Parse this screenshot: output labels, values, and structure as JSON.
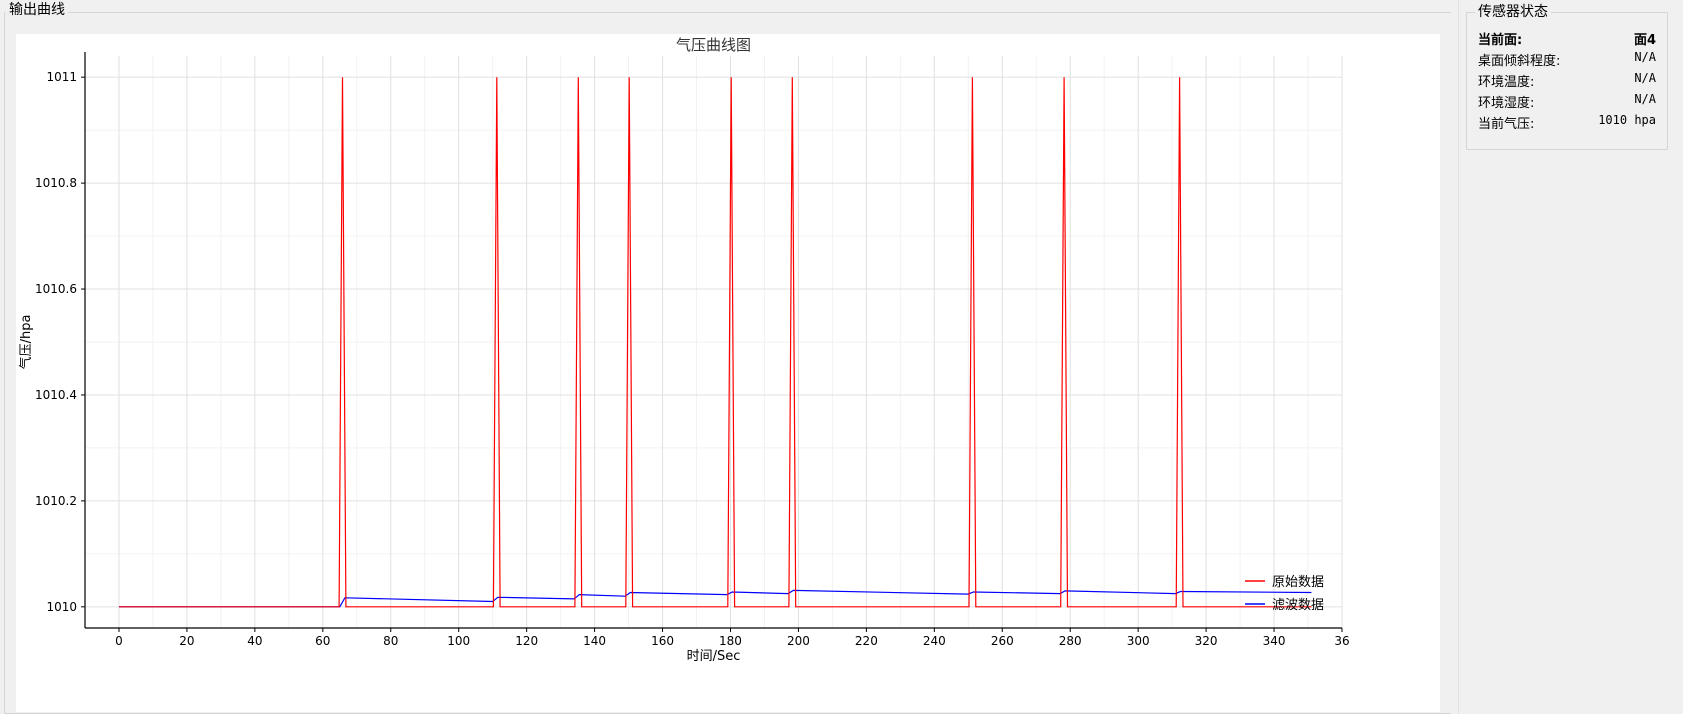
{
  "output_group": {
    "title": "输出曲线"
  },
  "status_group": {
    "title": "传感器状态",
    "rows": [
      {
        "label": "当前面:",
        "value": "面4",
        "bold": true
      },
      {
        "label": "桌面倾斜程度:",
        "value": "N/A"
      },
      {
        "label": "环境温度:",
        "value": "N/A"
      },
      {
        "label": "环境湿度:",
        "value": "N/A"
      },
      {
        "label": "当前气压:",
        "value": "1010 hpa"
      }
    ]
  },
  "chart_data": {
    "type": "line",
    "title": "气压曲线图",
    "xlabel": "时间/Sec",
    "ylabel": "气压/hpa",
    "xlim": [
      -10,
      360
    ],
    "ylim": [
      1009.96,
      1011.04
    ],
    "x_ticks": [
      0,
      20,
      40,
      60,
      80,
      100,
      120,
      140,
      160,
      180,
      200,
      220,
      240,
      260,
      280,
      300,
      320,
      340,
      360
    ],
    "x_tick_labels": [
      "0",
      "20",
      "40",
      "60",
      "80",
      "100",
      "120",
      "140",
      "160",
      "180",
      "200",
      "220",
      "240",
      "260",
      "280",
      "300",
      "320",
      "340",
      "36"
    ],
    "y_ticks": [
      1010,
      1010.2,
      1010.4,
      1010.6,
      1010.8,
      1011
    ],
    "y_tick_labels": [
      "1010",
      "1010.2",
      "1010.4",
      "1010.6",
      "1010.8",
      "1011"
    ],
    "grid": true,
    "legend_position": "bottom-right",
    "series": [
      {
        "name": "原始数据",
        "color": "#ff0000",
        "x": [
          0,
          64.8,
          65.8,
          66.8,
          110.2,
          111.2,
          112.2,
          134.2,
          135.2,
          136.2,
          149.2,
          150.2,
          151.2,
          179.2,
          180.2,
          181.2,
          197.2,
          198.2,
          199.2,
          250.2,
          251.2,
          252.2,
          277.2,
          278.2,
          279.2,
          311.2,
          312.2,
          313.2,
          351
        ],
        "y": [
          1010,
          1010,
          1011,
          1010,
          1010,
          1011,
          1010,
          1010,
          1011,
          1010,
          1010,
          1011,
          1010,
          1010,
          1011,
          1010,
          1010,
          1011,
          1010,
          1010,
          1011,
          1010,
          1010,
          1011,
          1010,
          1010,
          1011,
          1010,
          1010
        ]
      },
      {
        "name": "滤波数据",
        "color": "#0000ff",
        "x": [
          0,
          65,
          66.5,
          110,
          111.5,
          134,
          135.5,
          149,
          150.5,
          179,
          180.5,
          197,
          198.5,
          250,
          251.5,
          277,
          278.5,
          311,
          312.5,
          351
        ],
        "y": [
          1010,
          1010,
          1010.017,
          1010.01,
          1010.018,
          1010.015,
          1010.023,
          1010.02,
          1010.027,
          1010.023,
          1010.028,
          1010.025,
          1010.031,
          1010.024,
          1010.028,
          1010.025,
          1010.03,
          1010.025,
          1010.029,
          1010.027
        ]
      }
    ]
  }
}
